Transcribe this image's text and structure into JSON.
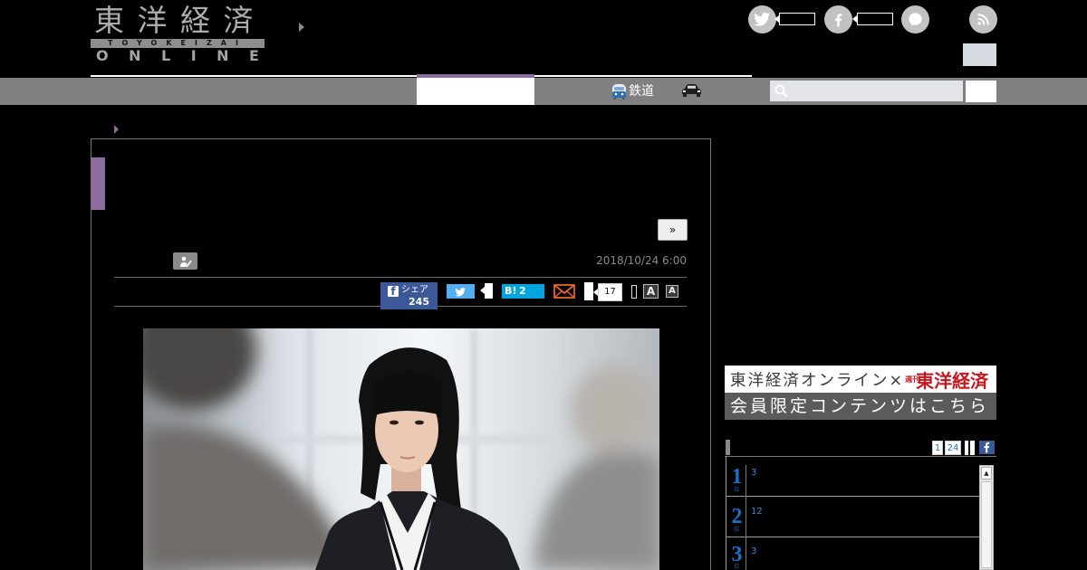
{
  "colors": {
    "accent": "#8c6b9e",
    "facebook": "#3b5998",
    "twitter": "#55acee",
    "hatena": "#00a4de",
    "rank_blue": "#1a73c7",
    "brand_red": "#c8161d",
    "mail_orange": "#e7652c"
  },
  "header": {
    "logo": {
      "title": "東洋経済",
      "band": "TOYOKEIZAI",
      "online": "ONLINE"
    },
    "social_icons": [
      "twitter-icon",
      "facebook-icon",
      "messenger-icon",
      "rss-icon"
    ]
  },
  "nav": {
    "items": [
      {
        "label": "鉄道",
        "icon": "train-icon"
      },
      {
        "icon": "car-icon"
      }
    ],
    "search_icon": "search-icon"
  },
  "article": {
    "next_label": "»",
    "author_icon": "author-pen-icon",
    "date": "2018/10/24 6:00",
    "share": {
      "facebook_label": "シェア",
      "facebook_count": "245",
      "hatena_label": "B!",
      "hatena_count": "2",
      "mail_icon": "mail-icon",
      "count": "17",
      "font_large": "A",
      "font_small": "A"
    }
  },
  "sidebar": {
    "banner": {
      "line1": "東洋経済オンライン×",
      "tag": "週刊",
      "brand": "東洋経済",
      "line2": "会員限定コンテンツはこちら"
    },
    "ranking": {
      "tabs": [
        "1",
        "24"
      ],
      "items": [
        {
          "rank": "1",
          "suffix": "位",
          "count": "3"
        },
        {
          "rank": "2",
          "suffix": "位",
          "count": "12"
        },
        {
          "rank": "3",
          "suffix": "位",
          "count": "3"
        }
      ]
    }
  }
}
